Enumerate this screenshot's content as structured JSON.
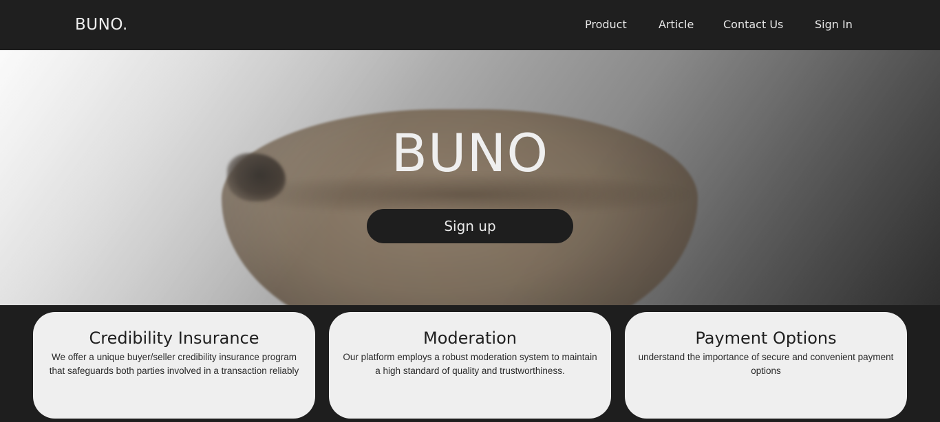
{
  "nav": {
    "brand": "BUNO.",
    "links": [
      {
        "label": "Product"
      },
      {
        "label": "Article"
      },
      {
        "label": "Contact Us"
      },
      {
        "label": "Sign In"
      }
    ]
  },
  "hero": {
    "title": "BUNO",
    "cta_label": "Sign up"
  },
  "features": [
    {
      "title": "Credibility Insurance",
      "text": "We offer a unique buyer/seller credibility insurance program that safeguards both parties involved in a transaction reliably"
    },
    {
      "title": "Moderation",
      "text": "Our platform employs a robust moderation system to maintain a high standard of quality and trustworthiness."
    },
    {
      "title": "Payment Options",
      "text": "understand the importance of secure and convenient payment options"
    }
  ],
  "colors": {
    "navbar_bg": "#1f1f1f",
    "page_bg": "#1e1e1e",
    "card_bg": "#efefef",
    "button_bg": "#1e1e1e",
    "hero_text": "#efefef"
  }
}
